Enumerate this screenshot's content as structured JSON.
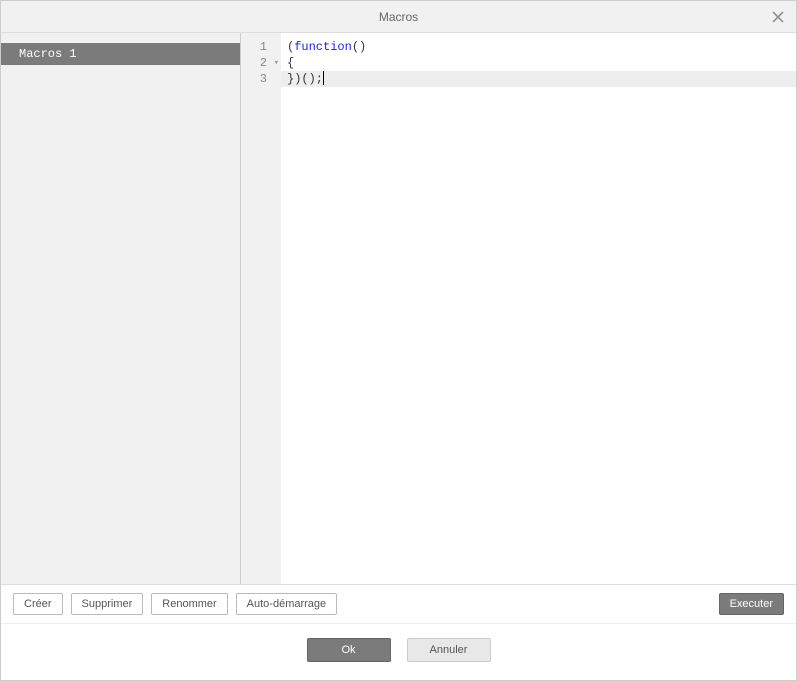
{
  "title": "Macros",
  "sidebar": {
    "items": [
      {
        "label": "Macros 1",
        "selected": true
      }
    ]
  },
  "editor": {
    "lines": [
      {
        "n": "1",
        "fold": "",
        "tokens": [
          {
            "t": "(",
            "c": "punc"
          },
          {
            "t": "function",
            "c": "kw"
          },
          {
            "t": "()",
            "c": "punc"
          }
        ]
      },
      {
        "n": "2",
        "fold": "▾",
        "tokens": [
          {
            "t": "{",
            "c": "punc"
          }
        ]
      },
      {
        "n": "3",
        "fold": "",
        "active": true,
        "tokens": [
          {
            "t": "})();",
            "c": "punc"
          }
        ],
        "cursor_after": true
      }
    ]
  },
  "toolbar": {
    "create": "Créer",
    "delete": "Supprimer",
    "rename": "Renommer",
    "autostart": "Auto-démarrage",
    "run": "Executer"
  },
  "footer": {
    "ok": "Ok",
    "cancel": "Annuler"
  }
}
